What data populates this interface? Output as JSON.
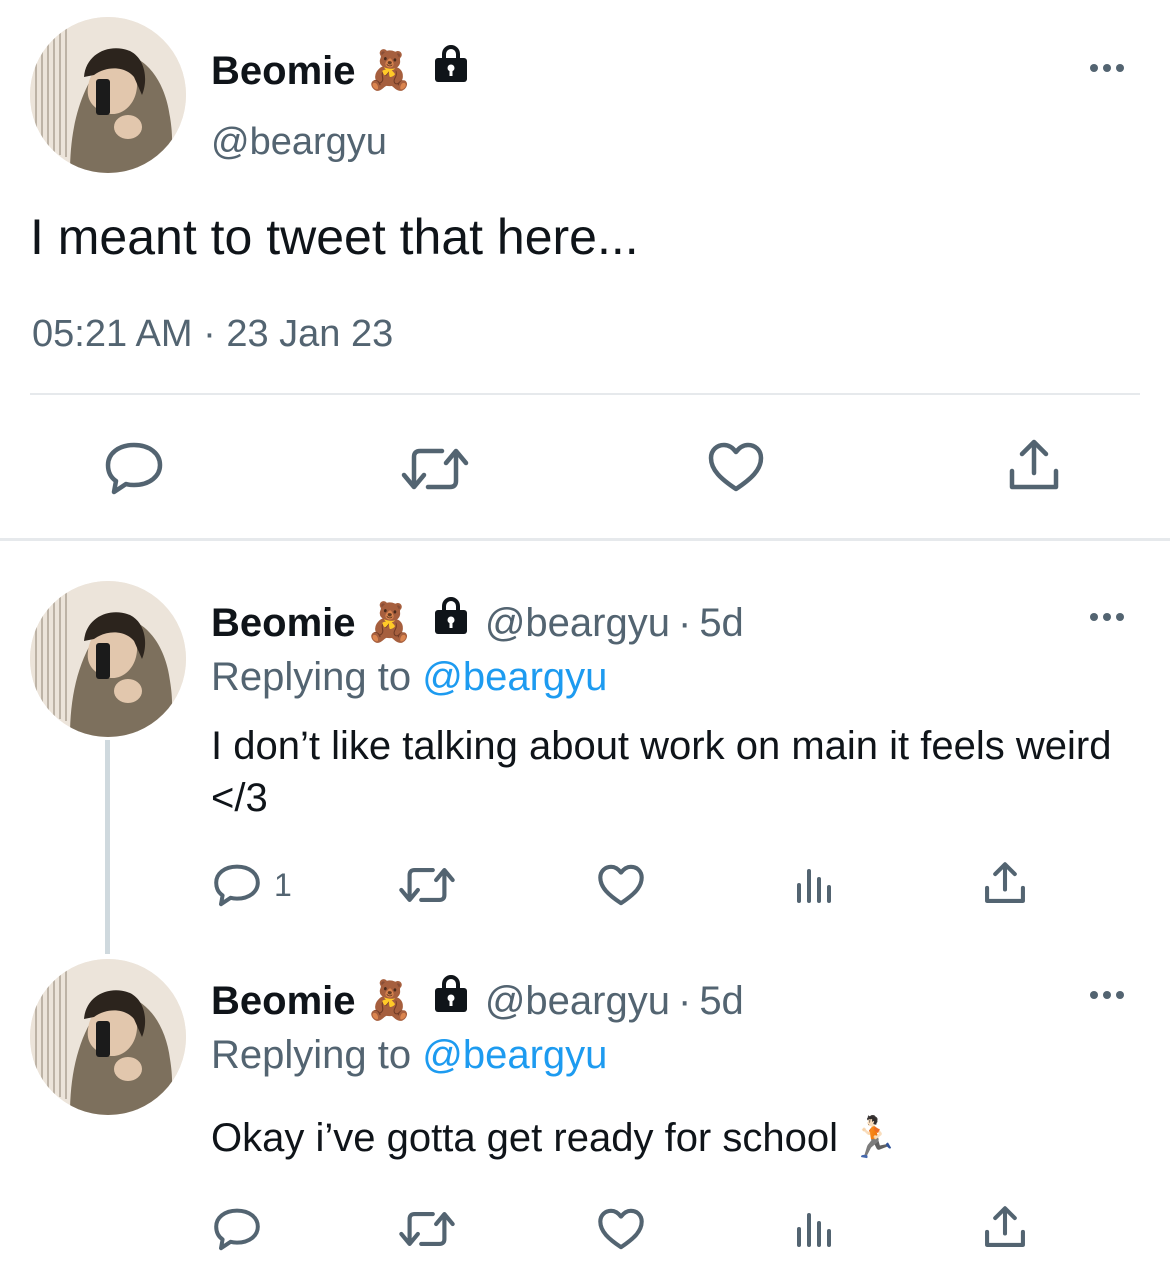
{
  "main_tweet": {
    "display_name": "Beomie",
    "name_emoji": "🧸",
    "handle": "@beargyu",
    "text": "I meant to tweet that here...",
    "timestamp": "05:21 AM · 23 Jan 23",
    "actions": [
      "reply-icon",
      "retweet-icon",
      "like-icon",
      "share-icon"
    ]
  },
  "replies": [
    {
      "display_name": "Beomie",
      "name_emoji": "🧸",
      "handle": "@beargyu",
      "separator": "·",
      "age": "5d",
      "replying_prefix": "Replying to",
      "replying_mention": "@beargyu",
      "text": "I don’t like talking about work on main it feels weird </3",
      "reply_count": "1"
    },
    {
      "display_name": "Beomie",
      "name_emoji": "🧸",
      "handle": "@beargyu",
      "separator": "·",
      "age": "5d",
      "replying_prefix": "Replying to",
      "replying_mention": "@beargyu",
      "text": "Okay i’ve gotta get ready for school 🏃🏻",
      "reply_count": ""
    }
  ],
  "colors": {
    "text": "#0f1419",
    "secondary": "#536471",
    "mention": "#1d9bf0",
    "divider": "#e6e9ec"
  }
}
